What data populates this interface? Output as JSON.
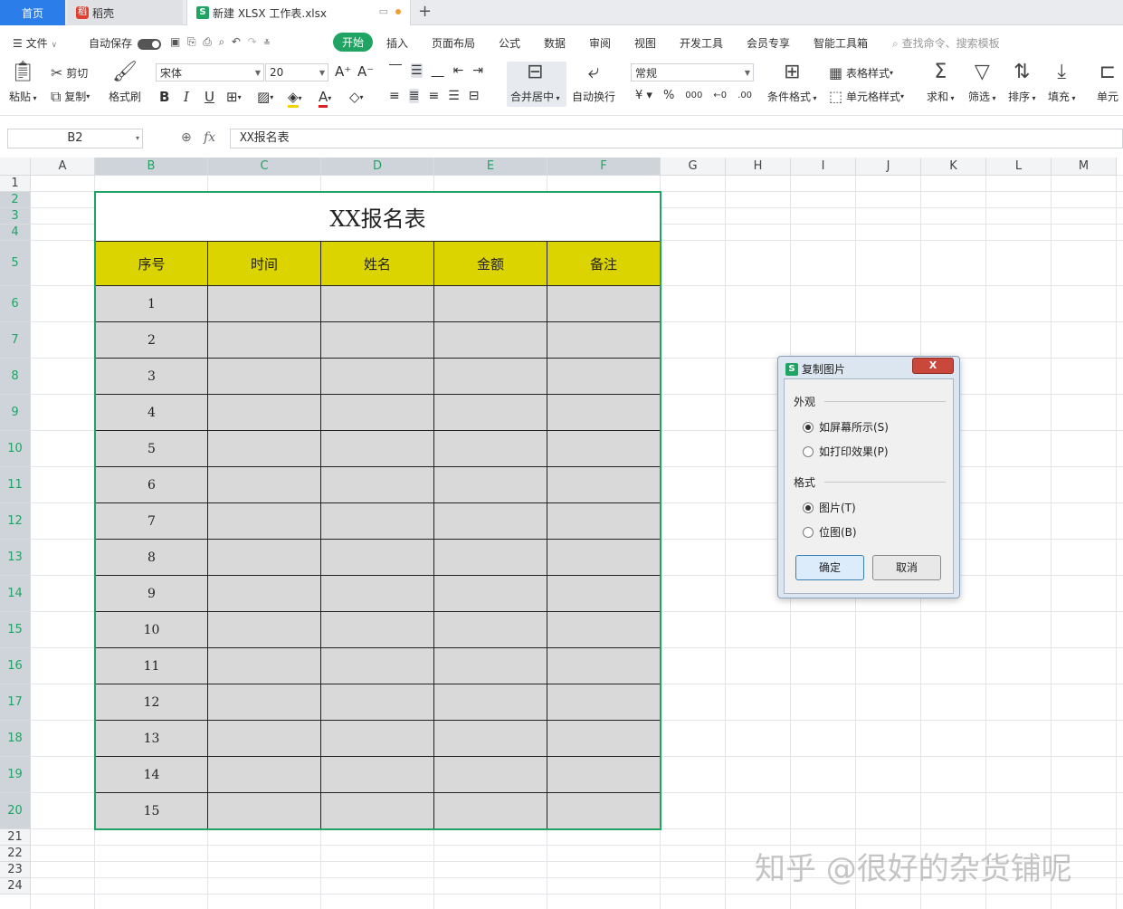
{
  "tabs": {
    "home": "首页",
    "docer": "稻壳",
    "file": "新建 XLSX 工作表.xlsx",
    "add": "+"
  },
  "menu": {
    "file": "文件",
    "autosave": "自动保存",
    "items": [
      "开始",
      "插入",
      "页面布局",
      "公式",
      "数据",
      "审阅",
      "视图",
      "开发工具",
      "会员专享",
      "智能工具箱"
    ],
    "search": "查找命令、搜索模板"
  },
  "ribbon": {
    "paste": "粘贴",
    "cut": "剪切",
    "copy": "复制",
    "format_painter": "格式刷",
    "font_name": "宋体",
    "font_size": "20",
    "merge_center": "合并居中",
    "wrap": "自动换行",
    "number_format": "常规",
    "cond_format": "条件格式",
    "table_style": "表格样式",
    "cell_style": "单元格样式",
    "sum": "求和",
    "filter": "筛选",
    "sort": "排序",
    "fill": "填充",
    "cell": "单元"
  },
  "formula_bar": {
    "name_box": "B2",
    "fx": "fx",
    "value": "XX报名表"
  },
  "columns": [
    "A",
    "B",
    "C",
    "D",
    "E",
    "F",
    "G",
    "H",
    "I",
    "J",
    "K",
    "L",
    "M"
  ],
  "rows": [
    "1",
    "2",
    "3",
    "4",
    "5",
    "6",
    "7",
    "8",
    "9",
    "10",
    "11",
    "12",
    "13",
    "14",
    "15",
    "16",
    "17",
    "18",
    "19",
    "20",
    "21",
    "22",
    "23",
    "24"
  ],
  "table": {
    "title": "XX报名表",
    "headers": [
      "序号",
      "时间",
      "姓名",
      "金额",
      "备注"
    ],
    "serials": [
      "1",
      "2",
      "3",
      "4",
      "5",
      "6",
      "7",
      "8",
      "9",
      "10",
      "11",
      "12",
      "13",
      "14",
      "15"
    ]
  },
  "dialog": {
    "title": "复制图片",
    "close": "X",
    "appearance_label": "外观",
    "opt_screen": "如屏幕所示(S)",
    "opt_print": "如打印效果(P)",
    "format_label": "格式",
    "opt_picture": "图片(T)",
    "opt_bitmap": "位图(B)",
    "ok": "确定",
    "cancel": "取消"
  },
  "watermark": "知乎 @很好的杂货铺呢"
}
